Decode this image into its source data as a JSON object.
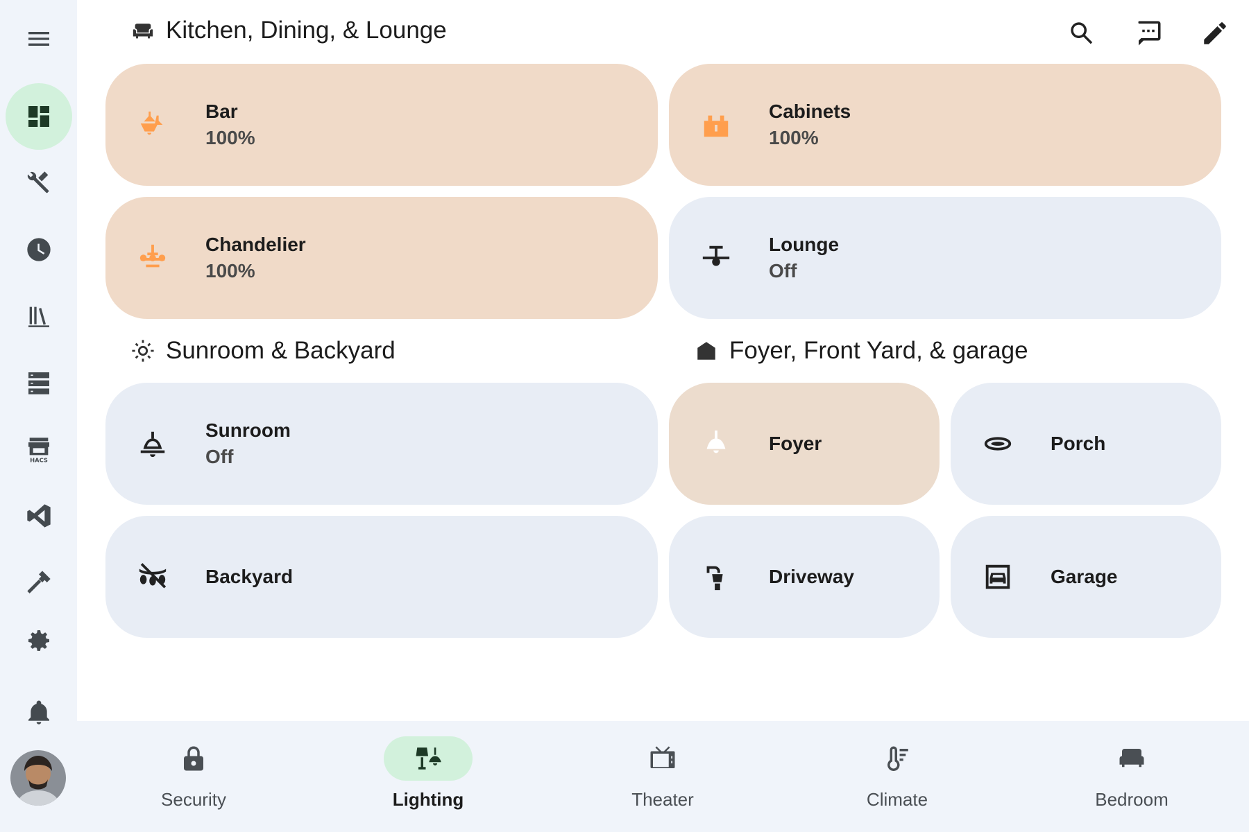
{
  "colors": {
    "sidebar_bg": "#f0f4fa",
    "active_green": "#d2f1dc",
    "tile_on_bg": "#f0dac8",
    "tile_off_bg": "#e8edf5",
    "light_on_icon": "#ff9e4d"
  },
  "sidebar": {
    "items": [
      {
        "icon": "menu-icon"
      },
      {
        "icon": "dashboard-icon",
        "active": true
      },
      {
        "icon": "tools-icon"
      },
      {
        "icon": "clock-icon"
      },
      {
        "icon": "library-icon"
      },
      {
        "icon": "server-icon"
      },
      {
        "icon": "hacs-store-icon",
        "text": "HACS"
      },
      {
        "icon": "vscode-icon"
      },
      {
        "icon": "hammer-icon"
      },
      {
        "icon": "gear-icon"
      },
      {
        "icon": "bell-icon"
      }
    ],
    "avatar_icon": "user-avatar"
  },
  "header": {
    "title": "Kitchen, Dining, & Lounge",
    "title_icon": "sofa-icon",
    "actions": [
      "search-icon",
      "chat-icon",
      "pencil-icon"
    ]
  },
  "sections": {
    "sunroom": {
      "title": "Sunroom & Backyard",
      "icon": "sun-icon"
    },
    "foyer": {
      "title": "Foyer, Front Yard, & garage",
      "icon": "house-icon"
    }
  },
  "tiles": {
    "bar": {
      "name": "Bar",
      "state": "100%",
      "icon": "pendant-lights-icon"
    },
    "cabinets": {
      "name": "Cabinets",
      "state": "100%",
      "icon": "cabinet-light-icon"
    },
    "chandelier": {
      "name": "Chandelier",
      "state": "100%",
      "icon": "chandelier-icon"
    },
    "lounge": {
      "name": "Lounge",
      "state": "Off",
      "icon": "ceiling-fan-icon"
    },
    "sunroom": {
      "name": "Sunroom",
      "state": "Off",
      "icon": "ceiling-light-icon"
    },
    "foyer": {
      "name": "Foyer",
      "icon": "pendant-light-icon"
    },
    "porch": {
      "name": "Porch",
      "icon": "flush-light-icon"
    },
    "backyard": {
      "name": "Backyard",
      "icon": "string-lights-off-icon"
    },
    "driveway": {
      "name": "Driveway",
      "icon": "outdoor-lamp-icon"
    },
    "garage": {
      "name": "Garage",
      "icon": "garage-icon"
    }
  },
  "bottom_nav": [
    {
      "label": "Security",
      "icon": "lock-icon"
    },
    {
      "label": "Lighting",
      "icon": "lamps-icon",
      "active": true
    },
    {
      "label": "Theater",
      "icon": "tv-icon"
    },
    {
      "label": "Climate",
      "icon": "thermometer-icon"
    },
    {
      "label": "Bedroom",
      "icon": "bed-icon"
    }
  ]
}
